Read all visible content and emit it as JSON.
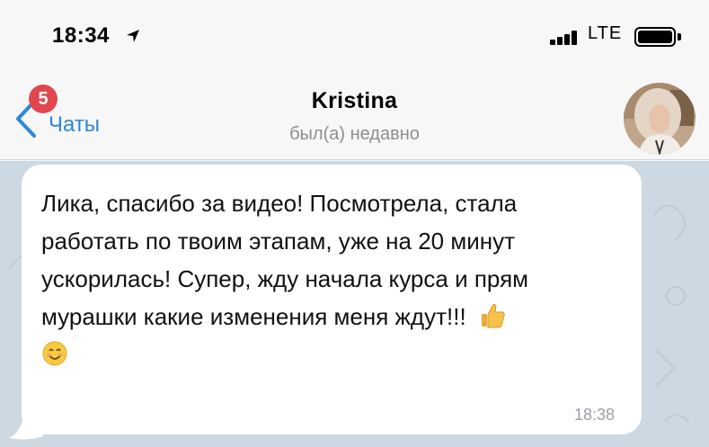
{
  "status_bar": {
    "time": "18:34",
    "carrier": "LTE",
    "location_icon": "location-arrow-icon",
    "signal_icon": "cellular-signal-icon",
    "battery_icon": "battery-icon"
  },
  "nav": {
    "back_label": "Чаты",
    "unread_count": "5",
    "back_icon": "chevron-left-icon",
    "contact_name": "Kristina",
    "last_seen": "был(а) недавно"
  },
  "message": {
    "lines": [
      "Лика, спасибо за видео! Посмотрела, стала",
      "работать по твоим этапам, уже на 20 минут",
      "ускорилась! Супер, жду начала курса и прям",
      "мурашки какие изменения меня ждут!!!"
    ],
    "emoji_1": "thumbs-up-emoji",
    "emoji_2": "smiling-face-emoji",
    "time": "18:38"
  },
  "colors": {
    "accent": "#2d87d8",
    "badge": "#e0474f",
    "chat_background": "#cdd9e2",
    "bubble": "#ffffff"
  }
}
